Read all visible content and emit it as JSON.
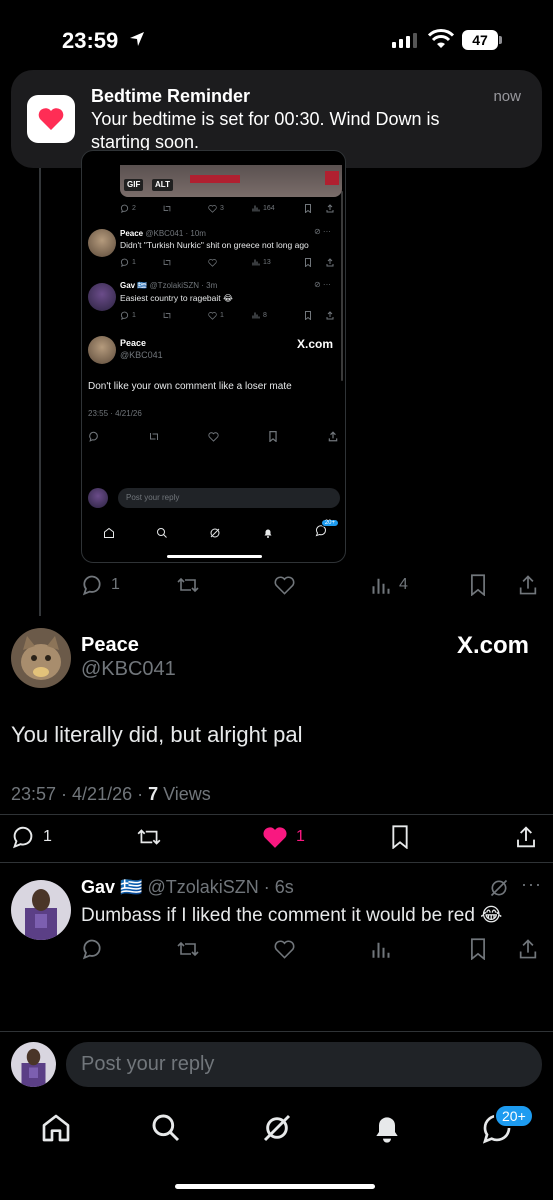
{
  "status_bar": {
    "time": "23:59",
    "battery": "47"
  },
  "notification": {
    "title": "Bedtime Reminder",
    "body": "Your bedtime is set for 00:30. Wind Down is starting soon.",
    "time": "now"
  },
  "embed": {
    "media_badges": [
      "GIF",
      "ALT"
    ],
    "first_actions": {
      "replies": "2",
      "likes": "3",
      "views": "164"
    },
    "posts": [
      {
        "name": "Peace",
        "handle": "@KBC041 · 10m",
        "text": "Didn't \"Turkish Nurkic\" shit on greece not long ago",
        "replies": "1",
        "views": "13"
      },
      {
        "name": "Gav",
        "flag": "🇬🇷",
        "handle": "@TzolakiSZN · 3m",
        "text": "Easiest country to ragebait 😂",
        "replies": "1",
        "likes": "1",
        "views": "8"
      }
    ],
    "focus": {
      "name": "Peace",
      "handle": "@KBC041",
      "xcom": "X.com",
      "text": "Don't like your own comment like a loser mate",
      "date": "23:55 · 4/21/26"
    },
    "reply_placeholder": "Post your reply",
    "nav_badge": "20+"
  },
  "embed_post_actions": {
    "replies": "1",
    "views": "4"
  },
  "focused_post": {
    "name": "Peace",
    "handle": "@KBC041",
    "xcom": "X.com",
    "text": "You literally did, but alright pal",
    "datetime": "23:57 · 4/21/26 · ",
    "views_count": "7",
    "views_label": " Views",
    "replies": "1",
    "likes": "1"
  },
  "reply": {
    "name": "Gav",
    "flag": "🇬🇷",
    "handle_time": "@TzolakiSZN · 6s",
    "text": "Dumbass if I liked the comment it would be red 😂"
  },
  "reply_bar": {
    "placeholder": "Post your reply"
  },
  "bottom_nav": {
    "badge": "20+"
  },
  "colors": {
    "like_active": "#f91880",
    "accent": "#1d9bf0",
    "muted": "#71767b"
  },
  "icons": [
    "home-icon",
    "search-icon",
    "grok-icon",
    "bell-icon",
    "messages-icon"
  ]
}
